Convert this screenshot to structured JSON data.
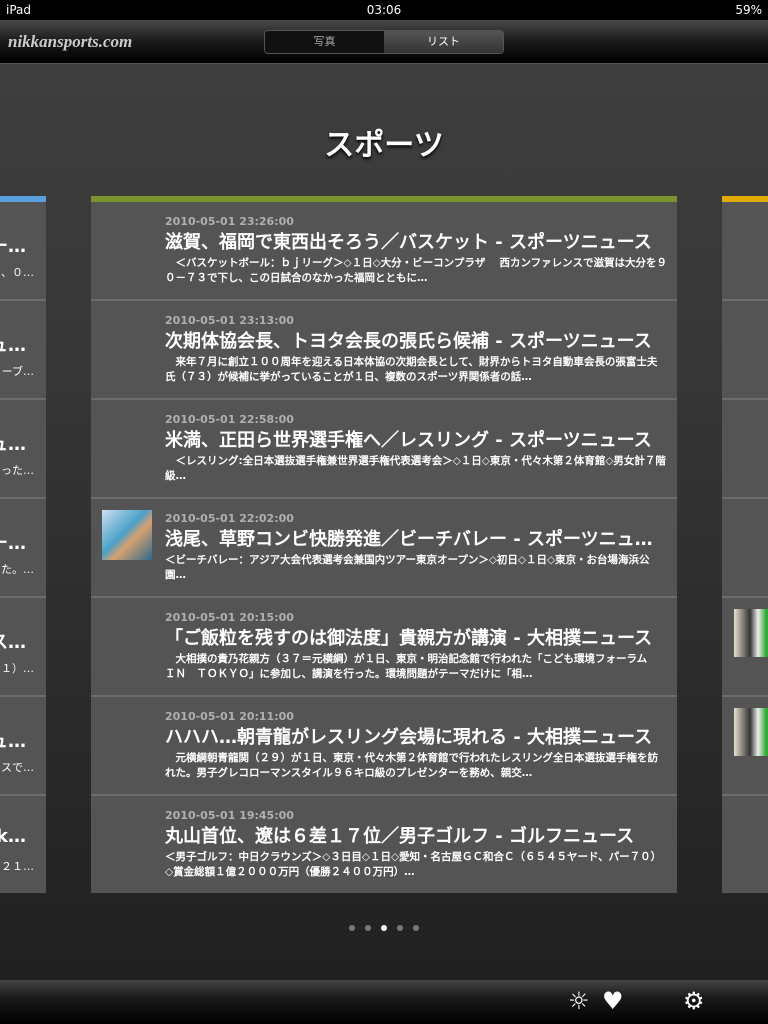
{
  "status": {
    "device": "iPad",
    "time": "03:06",
    "battery": "59%"
  },
  "nav": {
    "logo": "nikkansports.com",
    "segments": [
      "写真",
      "リスト"
    ],
    "selected": 1
  },
  "page_title": "スポーツ",
  "colors": {
    "main_bar": "#7a962a",
    "left_bar": "#5aa0dc",
    "right_bar": "#e0aa00"
  },
  "articles": [
    {
      "date": "2010-05-01 23:26:00",
      "title": "滋賀、福岡で東西出そろう／バスケット - スポーツニュース",
      "summary": "　＜バスケットボール：ｂｊリーグ＞◇１日◇大分・ビーコンプラザ\n　西カンファレンスで滋賀は大分を９０－７３で下し、この日試合のなかった福岡とともに…",
      "thumb": false
    },
    {
      "date": "2010-05-01 23:13:00",
      "title": "次期体協会長、トヨタ会長の張氏ら候補 - スポーツニュース",
      "summary": "　来年７月に創立１００周年を迎える日本体協の次期会長として、財界からトヨタ自動車会長の張富士夫氏（７３）が候補に挙がっていることが１日、複数のスポーツ界関係者の話…",
      "thumb": false
    },
    {
      "date": "2010-05-01 22:58:00",
      "title": "米満、正田ら世界選手権へ／レスリング - スポーツニュース",
      "summary": "　＜レスリング:全日本選抜選手権兼世界選手権代表選考会＞◇１日◇東京・代々木第２体育館◇男女計７階級…",
      "thumb": false
    },
    {
      "date": "2010-05-01 22:02:00",
      "title": "浅尾、草野コンビ快勝発進／ビーチバレー - スポーツニュース",
      "summary": "＜ビーチバレー：アジア大会代表選考会兼国内ツアー東京オープン＞◇初日◇１日◇東京・お台場海浜公園…",
      "thumb": true
    },
    {
      "date": "2010-05-01 20:15:00",
      "title": "「ご飯粒を残すのは御法度」貴親方が講演 - 大相撲ニュース",
      "summary": "　大相撲の貴乃花親方（３７＝元横綱）が１日、東京・明治記念館で行われた「こども環境フォーラム　ＩＮ　ＴＯＫＹＯ」に参加し、講演を行った。環境問題がテーマだけに「相…",
      "thumb": false
    },
    {
      "date": "2010-05-01 20:11:00",
      "title": "ハハハ…朝青龍がレスリング会場に現れる - 大相撲ニュース",
      "summary": "　元横綱朝青龍関（２９）が１日、東京・代々木第２体育館で行われたレスリング全日本選抜選手権を訪れた。男子グレコローマンスタイル９６キロ級のプレゼンターを務め、親交…",
      "thumb": false
    },
    {
      "date": "2010-05-01 19:45:00",
      "title": "丸山首位、遼は６差１７位／男子ゴルフ - ゴルフニュース",
      "summary": "＜男子ゴルフ：中日クラウンズ＞◇３日目◇１日◇愛知・名古屋ＧＣ和合Ｃ（６５４５ヤード、パー７０）◇賞金総額１億２０００万円（優勝２４００万円）…",
      "thumb": false
    }
  ],
  "left_panel": [
    {
      "title": "ー…",
      "summary": "、０…"
    },
    {
      "title": "ュ…",
      "summary": "ーブ…"
    },
    {
      "title": "ュ…",
      "summary": "った…"
    },
    {
      "title": "ー…",
      "summary": "た。…"
    },
    {
      "title": "ス…",
      "summary": "１）…"
    },
    {
      "title": "ュ…",
      "summary": "スで…"
    },
    {
      "title": "ik…",
      "summary": "２１…"
    }
  ],
  "right_panel_thumbs": [
    false,
    false,
    false,
    false,
    true,
    true,
    false
  ],
  "pager": {
    "count": 5,
    "current": 2
  },
  "toolbar": {
    "icons": [
      "sun-icon",
      "heart-icon",
      "gear-icon"
    ]
  }
}
